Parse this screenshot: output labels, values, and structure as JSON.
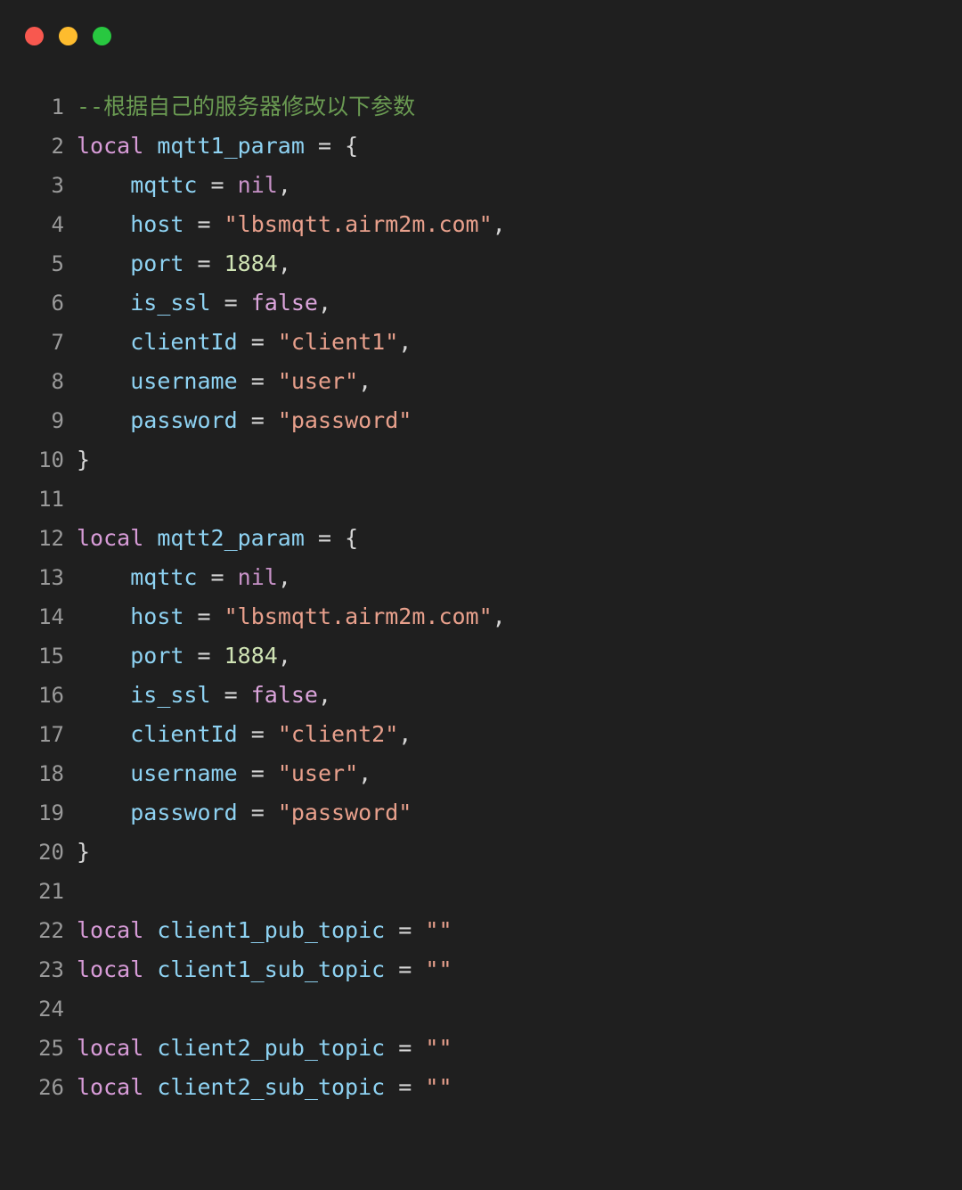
{
  "window": {
    "background_color": "#1f1f1f",
    "traffic_lights": [
      {
        "name": "close",
        "color": "#f8584f"
      },
      {
        "name": "minimize",
        "color": "#febc2e"
      },
      {
        "name": "maximize",
        "color": "#28c840"
      }
    ]
  },
  "editor": {
    "language": "lua",
    "gutter_color": "#9a9a9a",
    "theme_colors": {
      "background": "#1f1f1f",
      "comment": "#6a9a52",
      "keyword": "#d79bd7",
      "identifier": "#8ed2f2",
      "string": "#e8a08c",
      "number": "#cfe3b4",
      "constant": "#c892c8",
      "boolean": "#dba4db",
      "punctuation": "#d6d6d6"
    },
    "lines": [
      {
        "number": "1",
        "tokens": [
          {
            "t": "--根据自己的服务器修改以下参数",
            "c": "comment"
          }
        ]
      },
      {
        "number": "2",
        "tokens": [
          {
            "t": "local",
            "c": "keyword"
          },
          {
            "t": " ",
            "c": "plain"
          },
          {
            "t": "mqtt1_param",
            "c": "ident"
          },
          {
            "t": " ",
            "c": "plain"
          },
          {
            "t": "=",
            "c": "op"
          },
          {
            "t": " ",
            "c": "plain"
          },
          {
            "t": "{",
            "c": "punct"
          }
        ]
      },
      {
        "number": "3",
        "tokens": [
          {
            "t": "    ",
            "c": "plain"
          },
          {
            "t": "mqttc",
            "c": "prop"
          },
          {
            "t": " ",
            "c": "plain"
          },
          {
            "t": "=",
            "c": "op"
          },
          {
            "t": " ",
            "c": "plain"
          },
          {
            "t": "nil",
            "c": "const"
          },
          {
            "t": ",",
            "c": "punct"
          }
        ]
      },
      {
        "number": "4",
        "tokens": [
          {
            "t": "    ",
            "c": "plain"
          },
          {
            "t": "host",
            "c": "prop"
          },
          {
            "t": " ",
            "c": "plain"
          },
          {
            "t": "=",
            "c": "op"
          },
          {
            "t": " ",
            "c": "plain"
          },
          {
            "t": "\"lbsmqtt.airm2m.com\"",
            "c": "string"
          },
          {
            "t": ",",
            "c": "punct"
          }
        ]
      },
      {
        "number": "5",
        "tokens": [
          {
            "t": "    ",
            "c": "plain"
          },
          {
            "t": "port",
            "c": "prop"
          },
          {
            "t": " ",
            "c": "plain"
          },
          {
            "t": "=",
            "c": "op"
          },
          {
            "t": " ",
            "c": "plain"
          },
          {
            "t": "1884",
            "c": "number"
          },
          {
            "t": ",",
            "c": "punct"
          }
        ]
      },
      {
        "number": "6",
        "tokens": [
          {
            "t": "    ",
            "c": "plain"
          },
          {
            "t": "is_ssl",
            "c": "prop"
          },
          {
            "t": " ",
            "c": "plain"
          },
          {
            "t": "=",
            "c": "op"
          },
          {
            "t": " ",
            "c": "plain"
          },
          {
            "t": "false",
            "c": "bool"
          },
          {
            "t": ",",
            "c": "punct"
          }
        ]
      },
      {
        "number": "7",
        "tokens": [
          {
            "t": "    ",
            "c": "plain"
          },
          {
            "t": "clientId",
            "c": "prop"
          },
          {
            "t": " ",
            "c": "plain"
          },
          {
            "t": "=",
            "c": "op"
          },
          {
            "t": " ",
            "c": "plain"
          },
          {
            "t": "\"client1\"",
            "c": "string"
          },
          {
            "t": ",",
            "c": "punct"
          }
        ]
      },
      {
        "number": "8",
        "tokens": [
          {
            "t": "    ",
            "c": "plain"
          },
          {
            "t": "username",
            "c": "prop"
          },
          {
            "t": " ",
            "c": "plain"
          },
          {
            "t": "=",
            "c": "op"
          },
          {
            "t": " ",
            "c": "plain"
          },
          {
            "t": "\"user\"",
            "c": "string"
          },
          {
            "t": ",",
            "c": "punct"
          }
        ]
      },
      {
        "number": "9",
        "tokens": [
          {
            "t": "    ",
            "c": "plain"
          },
          {
            "t": "password",
            "c": "prop"
          },
          {
            "t": " ",
            "c": "plain"
          },
          {
            "t": "=",
            "c": "op"
          },
          {
            "t": " ",
            "c": "plain"
          },
          {
            "t": "\"password\"",
            "c": "string"
          }
        ]
      },
      {
        "number": "10",
        "tokens": [
          {
            "t": "}",
            "c": "punct"
          }
        ]
      },
      {
        "number": "11",
        "tokens": []
      },
      {
        "number": "12",
        "tokens": [
          {
            "t": "local",
            "c": "keyword"
          },
          {
            "t": " ",
            "c": "plain"
          },
          {
            "t": "mqtt2_param",
            "c": "ident"
          },
          {
            "t": " ",
            "c": "plain"
          },
          {
            "t": "=",
            "c": "op"
          },
          {
            "t": " ",
            "c": "plain"
          },
          {
            "t": "{",
            "c": "punct"
          }
        ]
      },
      {
        "number": "13",
        "tokens": [
          {
            "t": "    ",
            "c": "plain"
          },
          {
            "t": "mqttc",
            "c": "prop"
          },
          {
            "t": " ",
            "c": "plain"
          },
          {
            "t": "=",
            "c": "op"
          },
          {
            "t": " ",
            "c": "plain"
          },
          {
            "t": "nil",
            "c": "const"
          },
          {
            "t": ",",
            "c": "punct"
          }
        ]
      },
      {
        "number": "14",
        "tokens": [
          {
            "t": "    ",
            "c": "plain"
          },
          {
            "t": "host",
            "c": "prop"
          },
          {
            "t": " ",
            "c": "plain"
          },
          {
            "t": "=",
            "c": "op"
          },
          {
            "t": " ",
            "c": "plain"
          },
          {
            "t": "\"lbsmqtt.airm2m.com\"",
            "c": "string"
          },
          {
            "t": ",",
            "c": "punct"
          }
        ]
      },
      {
        "number": "15",
        "tokens": [
          {
            "t": "    ",
            "c": "plain"
          },
          {
            "t": "port",
            "c": "prop"
          },
          {
            "t": " ",
            "c": "plain"
          },
          {
            "t": "=",
            "c": "op"
          },
          {
            "t": " ",
            "c": "plain"
          },
          {
            "t": "1884",
            "c": "number"
          },
          {
            "t": ",",
            "c": "punct"
          }
        ]
      },
      {
        "number": "16",
        "tokens": [
          {
            "t": "    ",
            "c": "plain"
          },
          {
            "t": "is_ssl",
            "c": "prop"
          },
          {
            "t": " ",
            "c": "plain"
          },
          {
            "t": "=",
            "c": "op"
          },
          {
            "t": " ",
            "c": "plain"
          },
          {
            "t": "false",
            "c": "bool"
          },
          {
            "t": ",",
            "c": "punct"
          }
        ]
      },
      {
        "number": "17",
        "tokens": [
          {
            "t": "    ",
            "c": "plain"
          },
          {
            "t": "clientId",
            "c": "prop"
          },
          {
            "t": " ",
            "c": "plain"
          },
          {
            "t": "=",
            "c": "op"
          },
          {
            "t": " ",
            "c": "plain"
          },
          {
            "t": "\"client2\"",
            "c": "string"
          },
          {
            "t": ",",
            "c": "punct"
          }
        ]
      },
      {
        "number": "18",
        "tokens": [
          {
            "t": "    ",
            "c": "plain"
          },
          {
            "t": "username",
            "c": "prop"
          },
          {
            "t": " ",
            "c": "plain"
          },
          {
            "t": "=",
            "c": "op"
          },
          {
            "t": " ",
            "c": "plain"
          },
          {
            "t": "\"user\"",
            "c": "string"
          },
          {
            "t": ",",
            "c": "punct"
          }
        ]
      },
      {
        "number": "19",
        "tokens": [
          {
            "t": "    ",
            "c": "plain"
          },
          {
            "t": "password",
            "c": "prop"
          },
          {
            "t": " ",
            "c": "plain"
          },
          {
            "t": "=",
            "c": "op"
          },
          {
            "t": " ",
            "c": "plain"
          },
          {
            "t": "\"password\"",
            "c": "string"
          }
        ]
      },
      {
        "number": "20",
        "tokens": [
          {
            "t": "}",
            "c": "punct"
          }
        ]
      },
      {
        "number": "21",
        "tokens": []
      },
      {
        "number": "22",
        "tokens": [
          {
            "t": "local",
            "c": "keyword"
          },
          {
            "t": " ",
            "c": "plain"
          },
          {
            "t": "client1_pub_topic",
            "c": "ident"
          },
          {
            "t": " ",
            "c": "plain"
          },
          {
            "t": "=",
            "c": "op"
          },
          {
            "t": " ",
            "c": "plain"
          },
          {
            "t": "\"\"",
            "c": "string"
          }
        ]
      },
      {
        "number": "23",
        "tokens": [
          {
            "t": "local",
            "c": "keyword"
          },
          {
            "t": " ",
            "c": "plain"
          },
          {
            "t": "client1_sub_topic",
            "c": "ident"
          },
          {
            "t": " ",
            "c": "plain"
          },
          {
            "t": "=",
            "c": "op"
          },
          {
            "t": " ",
            "c": "plain"
          },
          {
            "t": "\"\"",
            "c": "string"
          }
        ]
      },
      {
        "number": "24",
        "tokens": []
      },
      {
        "number": "25",
        "tokens": [
          {
            "t": "local",
            "c": "keyword"
          },
          {
            "t": " ",
            "c": "plain"
          },
          {
            "t": "client2_pub_topic",
            "c": "ident"
          },
          {
            "t": " ",
            "c": "plain"
          },
          {
            "t": "=",
            "c": "op"
          },
          {
            "t": " ",
            "c": "plain"
          },
          {
            "t": "\"\"",
            "c": "string"
          }
        ]
      },
      {
        "number": "26",
        "tokens": [
          {
            "t": "local",
            "c": "keyword"
          },
          {
            "t": " ",
            "c": "plain"
          },
          {
            "t": "client2_sub_topic",
            "c": "ident"
          },
          {
            "t": " ",
            "c": "plain"
          },
          {
            "t": "=",
            "c": "op"
          },
          {
            "t": " ",
            "c": "plain"
          },
          {
            "t": "\"\"",
            "c": "string"
          }
        ]
      }
    ]
  }
}
